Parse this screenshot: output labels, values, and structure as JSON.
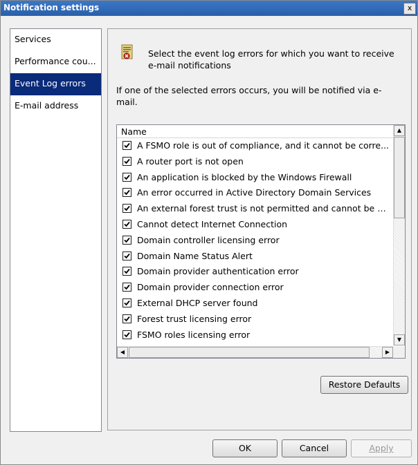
{
  "window": {
    "title": "Notification settings",
    "close_label": "x"
  },
  "nav": {
    "items": [
      {
        "label": "Services",
        "selected": false
      },
      {
        "label": "Performance cou...",
        "selected": false
      },
      {
        "label": "Event Log errors",
        "selected": true
      },
      {
        "label": "E-mail address",
        "selected": false
      }
    ]
  },
  "content": {
    "description": "Select the event log errors for which you want to receive e-mail notifications",
    "note": "If one of the selected errors occurs, you will be notified via e-mail.",
    "list": {
      "column_header": "Name",
      "rows": [
        {
          "label": "A FSMO role is out of compliance, and it cannot be corre...",
          "checked": true
        },
        {
          "label": "A router port is not open",
          "checked": true
        },
        {
          "label": "An application is blocked by the Windows Firewall",
          "checked": true
        },
        {
          "label": "An error occurred in Active Directory Domain Services",
          "checked": true
        },
        {
          "label": "An external forest trust is not permitted and cannot be fix...",
          "checked": true
        },
        {
          "label": "Cannot detect Internet Connection",
          "checked": true
        },
        {
          "label": "Domain controller licensing error",
          "checked": true
        },
        {
          "label": "Domain Name Status Alert",
          "checked": true
        },
        {
          "label": "Domain provider authentication error",
          "checked": true
        },
        {
          "label": "Domain provider connection error",
          "checked": true
        },
        {
          "label": "External DHCP server found",
          "checked": true
        },
        {
          "label": "Forest trust licensing error",
          "checked": true
        },
        {
          "label": "FSMO roles licensing error",
          "checked": true
        }
      ]
    },
    "restore_button": "Restore Defaults"
  },
  "footer": {
    "ok_label": "OK",
    "cancel_label": "Cancel",
    "apply_label": "Apply"
  },
  "colors": {
    "titlebar": "#2a5fa8",
    "selection": "#0a2a7a",
    "window_bg": "#f0f0f0"
  }
}
